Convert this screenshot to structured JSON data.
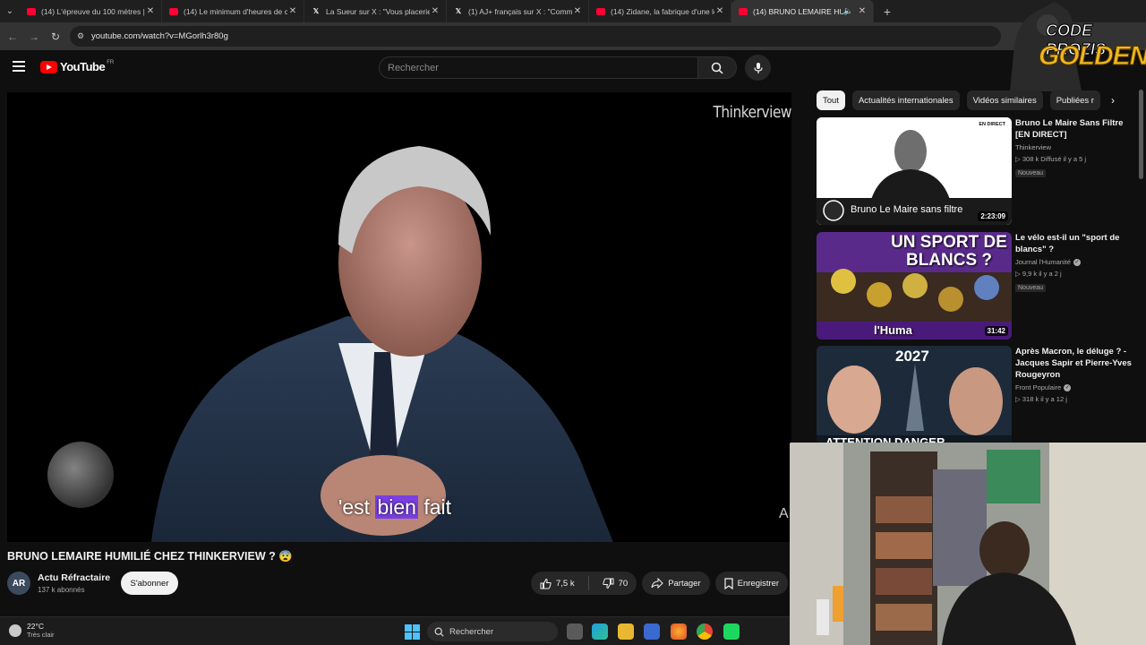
{
  "browser": {
    "tabs": [
      {
        "title": "(14) L'épreuve du 100 mètres |",
        "favicon": "youtube-icon",
        "active": false
      },
      {
        "title": "(14) Le minimum d'heures de c",
        "favicon": "youtube-icon",
        "active": false
      },
      {
        "title": "La Sueur sur X : \"Vous placeriez",
        "favicon": "x-icon",
        "active": false
      },
      {
        "title": "(1) AJ+ français sur X : \"Comme",
        "favicon": "x-icon",
        "active": false
      },
      {
        "title": "(14) Zidane, la fabrique d'une le",
        "favicon": "youtube-icon",
        "active": false
      },
      {
        "title": "(14) BRUNO LEMAIRE HUMI",
        "favicon": "youtube-icon",
        "active": true
      }
    ],
    "url": "youtube.com/watch?v=MGorlh3r80g"
  },
  "header": {
    "logo_text": "YouTube",
    "country_code": "FR",
    "search_placeholder": "Rechercher"
  },
  "player": {
    "watermark": "Thinkerview",
    "subtitle_pre": "'est ",
    "subtitle_highlight": "bien",
    "subtitle_post": " fait",
    "edge_letter": "A"
  },
  "video": {
    "title": "BRUNO LEMAIRE HUMILIÉ CHEZ THINKERVIEW ? 😨",
    "channel": {
      "initials": "AR",
      "name": "Actu Réfractaire",
      "subscribers": "137 k abonnés"
    },
    "subscribe_label": "S'abonner",
    "likes": "7,5 k",
    "dislikes": "70",
    "share_label": "Partager",
    "save_label": "Enregistrer"
  },
  "chips": [
    "Tout",
    "Actualités internationales",
    "Vidéos similaires",
    "Publiées r"
  ],
  "recommendations": [
    {
      "title": "Bruno Le Maire Sans Filtre [EN DIRECT]",
      "channel": "Thinkerview",
      "verified": false,
      "meta": "▷ 308 k   Diffusé il y a 5 j",
      "badge": "Nouveau",
      "duration": "2:23:09",
      "thumb_text": "Bruno Le Maire sans filtre",
      "live_tag": "EN DIRECT"
    },
    {
      "title": "Le vélo est-il un \"sport de blancs\" ?",
      "channel": "Journal l'Humanité",
      "verified": true,
      "meta": "▷ 9,9 k   il y a 2 j",
      "badge": "Nouveau",
      "duration": "31:42",
      "thumb_text": "UN SPORT DE BLANCS ?",
      "thumb_sub": "l'Huma"
    },
    {
      "title": "Après Macron, le déluge ? - Jacques Sapir et Pierre-Yves Rougeyron",
      "channel": "Front Populaire",
      "verified": true,
      "meta": "▷ 318 k   il y a 12 j",
      "badge": "",
      "duration": "",
      "thumb_text": "2027",
      "thumb_sub": "ATTENTION DANGER"
    }
  ],
  "overlay": {
    "line1": "CODE PROZIS",
    "line2": "GOLDENG"
  },
  "taskbar": {
    "temperature": "22°C",
    "condition": "Très clair",
    "search_label": "Rechercher"
  }
}
